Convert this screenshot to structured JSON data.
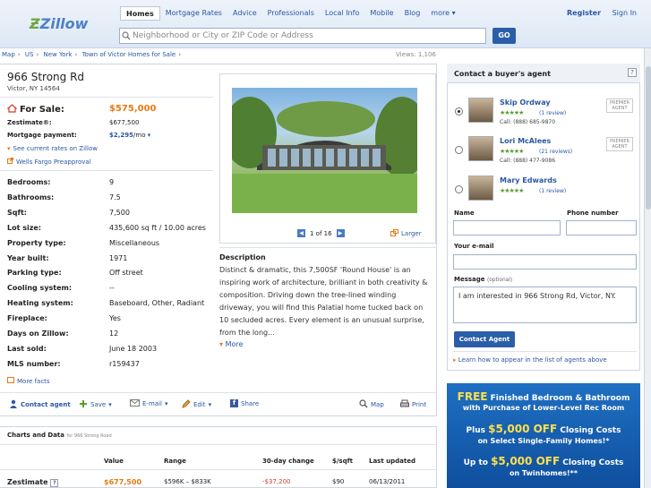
{
  "header": {
    "logo": "Zillow",
    "nav": [
      "Homes",
      "Mortgage Rates",
      "Advice",
      "Professionals",
      "Local Info",
      "Mobile",
      "Blog",
      "more"
    ],
    "register": "Register",
    "signin": "Sign In",
    "search_placeholder": "Neighborhood or City or ZIP Code or Address",
    "go": "GO"
  },
  "breadcrumb": [
    "Map",
    "US",
    "New York",
    "Town of Victor Homes for Sale"
  ],
  "views": "Views: 1,106",
  "listing": {
    "address": "966 Strong Rd",
    "city": "Victor, NY 14564",
    "for_sale_label": "For Sale:",
    "price": "$575,000",
    "zestimate_label": "Zestimate®:",
    "zestimate_value": "$677,500",
    "mortgage_label": "Mortgage payment:",
    "mortgage_value": "$2,295",
    "mortgage_unit": "/mo",
    "rates_link": "See current rates on Zillow",
    "preapproval_link": "Wells Fargo Preapproval",
    "facts": [
      {
        "label": "Bedrooms:",
        "value": "9"
      },
      {
        "label": "Bathrooms:",
        "value": "7.5"
      },
      {
        "label": "Sqft:",
        "value": "7,500"
      },
      {
        "label": "Lot size:",
        "value": "435,600 sq ft / 10.00 acres"
      },
      {
        "label": "Property type:",
        "value": "Miscellaneous"
      },
      {
        "label": "Year built:",
        "value": "1971"
      },
      {
        "label": "Parking type:",
        "value": "Off street"
      },
      {
        "label": "Cooling system:",
        "value": "--"
      },
      {
        "label": "Heating system:",
        "value": "Baseboard, Other, Radiant"
      },
      {
        "label": "Fireplace:",
        "value": "Yes"
      },
      {
        "label": "Days on Zillow:",
        "value": "12"
      },
      {
        "label": "Last sold:",
        "value": "June 18 2003"
      },
      {
        "label": "MLS number:",
        "value": "r159437"
      }
    ],
    "more_facts": "More facts",
    "photo_counter": "1 of 16",
    "larger": "Larger",
    "description_heading": "Description",
    "description": "Distinct & dramatic, this 7,500SF 'Round House' is an inspiring work of architecture, brilliant in both creativity & composition. Driving down the tree-lined winding driveway, you will find this Palatial home tucked back on 10 secluded acres. Every element is an unusual surprise, from the long...",
    "more": "More"
  },
  "actions": [
    "Contact agent",
    "Save",
    "E-mail",
    "Edit",
    "Share",
    "Map",
    "Print"
  ],
  "charts": {
    "heading": "Charts and Data",
    "subheading": "for 966 Strong Road",
    "columns": [
      "Value",
      "Range",
      "30-day change",
      "$/sqft",
      "Last updated"
    ],
    "row": {
      "label": "Zestimate",
      "value": "$677,500",
      "range": "$596K – $833K",
      "change": "-$37,200",
      "sqft": "$90",
      "updated": "06/13/2011"
    }
  },
  "agent_panel": {
    "heading": "Contact a buyer's agent",
    "help": "?",
    "agents": [
      {
        "name": "Skip Ordway",
        "reviews": "(1 review)",
        "call": "Call: (888) 685-9870",
        "badge": "PREMIER AGENT",
        "selected": true
      },
      {
        "name": "Lori McAlees",
        "reviews": "(21 reviews)",
        "call": "Call: (888) 477-9086",
        "badge": "PREMIER AGENT",
        "selected": false
      },
      {
        "name": "Mary Edwards",
        "reviews": "(1 review)",
        "call": "",
        "badge": "",
        "selected": false
      }
    ],
    "stars": "★★★★★",
    "name_label": "Name",
    "phone_label": "Phone number",
    "email_label": "Your e-mail",
    "message_label": "Message",
    "message_optional": "(optional)",
    "message_value": "I am interested in 966 Strong Rd, Victor, NY.",
    "contact_button": "Contact Agent",
    "learn_link": "Learn how to appear in the list of agents above"
  },
  "ad": {
    "free": "FREE",
    "l1": " Finished Bedroom & Bathroom",
    "l2": "with Purchase of Lower-Level Rec Room",
    "l3a": "Plus ",
    "l3b": "$5,000 OFF",
    "l3c": " Closing Costs",
    "l4": "on Select Single-Family Homes!*",
    "l5a": "Up to ",
    "l5b": "$5,000 OFF",
    "l5c": " Closing Costs",
    "l6": "on Twinhomes!**"
  }
}
